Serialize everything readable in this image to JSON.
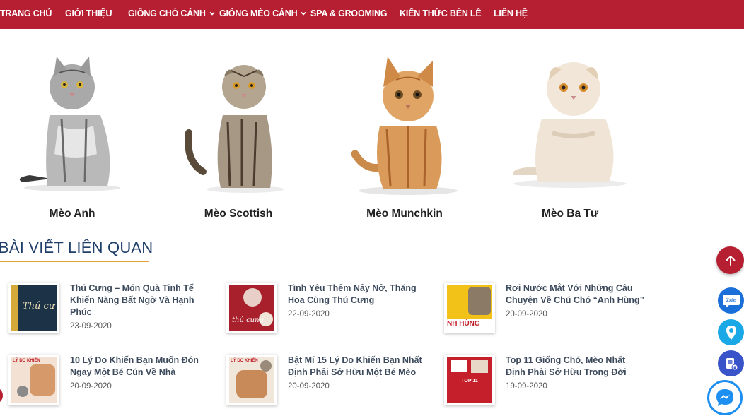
{
  "nav": {
    "items": [
      "TRANG CHỦ",
      "GIỚI THIỆU",
      "GIỐNG CHÓ CẢNH",
      "GIỐNG MÈO CẢNH",
      "SPA & GROOMING",
      "KIẾN THỨC BÊN LỀ",
      "LIÊN HỆ"
    ]
  },
  "cats": [
    {
      "name": "Mèo Anh"
    },
    {
      "name": "Mèo Scottish"
    },
    {
      "name": "Mèo Munchkin"
    },
    {
      "name": "Mèo Ba Tư"
    }
  ],
  "related": {
    "title": "BÀI VIẾT LIÊN QUAN",
    "articles": [
      {
        "title": "Thú Cưng – Món Quà Tinh Tế Khiến Nàng Bất Ngờ Và Hạnh Phúc",
        "date": "23-09-2020",
        "thumb_text": "Thú cư"
      },
      {
        "title": "Tình Yêu Thêm Nảy Nở, Thăng Hoa Cùng Thú Cưng",
        "date": "22-09-2020",
        "thumb_text": "thú cưng"
      },
      {
        "title": "Rơi Nước Mắt Với Những Câu Chuyện Về Chú Chó “Anh Hùng”",
        "date": "20-09-2020",
        "thumb_text": "NH HÙNG"
      },
      {
        "title": "10 Lý Do Khiến Bạn Muốn Đón Ngay Một Bé Cún Về Nhà",
        "date": "20-09-2020",
        "thumb_text": "LÝ DO KHIẾN"
      },
      {
        "title": "Bật Mí 15 Lý Do Khiến Bạn Nhất Định Phải Sở Hữu Một Bé Mèo",
        "date": "20-09-2020",
        "thumb_text": "LÝ DO KHIẾN"
      },
      {
        "title": "Top 11 Giống Chó, Mèo Nhất Định Phải Sở Hữu Trong Đời",
        "date": "19-09-2020",
        "thumb_text": "TOP 11"
      }
    ]
  },
  "floating": {
    "zalo_label": "Zalo"
  },
  "colors": {
    "brand_red": "#b61f31",
    "title_blue": "#1f3f6a",
    "underline_orange": "#e8a23b"
  }
}
